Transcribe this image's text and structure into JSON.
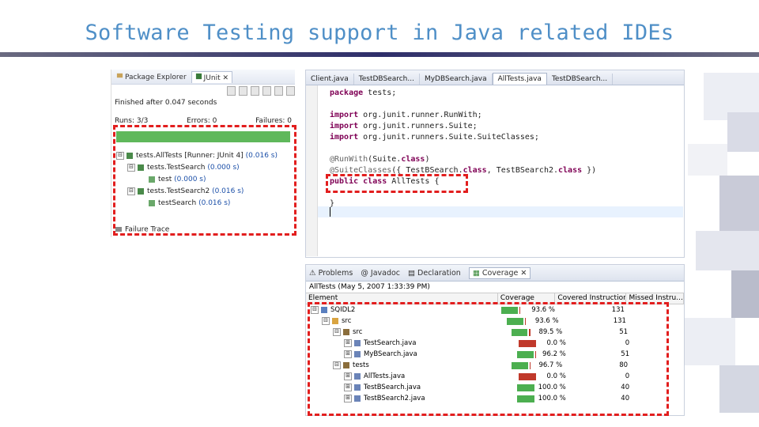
{
  "slide_title": "Software Testing support in Java related IDEs",
  "junit": {
    "tab_package_explorer": "Package Explorer",
    "tab_junit": "JUnit",
    "finished_text": "Finished after 0.047 seconds",
    "runs_label": "Runs: 3/3",
    "errors_label": "Errors: 0",
    "failures_label": "Failures: 0",
    "tree": [
      {
        "expander": "⊟",
        "name": "tests.AllTests [Runner: JUnit 4]",
        "time": "(0.016 s)",
        "indent": 0
      },
      {
        "expander": "⊟",
        "name": "tests.TestSearch",
        "time": "(0.000 s)",
        "indent": 1
      },
      {
        "expander": "",
        "name": "test",
        "time": "(0.000 s)",
        "indent": 2
      },
      {
        "expander": "⊟",
        "name": "tests.TestSearch2",
        "time": "(0.016 s)",
        "indent": 1
      },
      {
        "expander": "",
        "name": "testSearch",
        "time": "(0.016 s)",
        "indent": 2
      }
    ],
    "failure_trace_label": "Failure Trace"
  },
  "editor": {
    "tabs": [
      "Client.java",
      "TestDBSearch...",
      "MyDBSearch.java",
      "AllTests.java",
      "TestDBSearch..."
    ],
    "active_tab": 3,
    "code": {
      "line1_kw": "package",
      "line1_rest": " tests;",
      "line2_kw": "import",
      "line2_rest": " org.junit.runner.RunWith;",
      "line3_kw": "import",
      "line3_rest": " org.junit.runners.Suite;",
      "line4_kw": "import",
      "line4_rest": " org.junit.runners.Suite.SuiteClasses;",
      "line5_ann": "@RunWith",
      "line5_a": "(Suite.",
      "line5_kw": "class",
      "line5_b": ")",
      "line6_ann": "@SuiteClasses",
      "line6_a": "({ TestBSearch.",
      "line6_kw1": "class",
      "line6_b": ", TestBSearch2.",
      "line6_kw2": "class",
      "line6_c": " })",
      "line7_kw1": "public",
      "line7_kw2": "class",
      "line7_rest": " AllTests {",
      "line8": "}"
    }
  },
  "coverage": {
    "tabs": [
      "Problems",
      "Javadoc",
      "Declaration",
      "Coverage"
    ],
    "session": "AllTests (May 5, 2007 1:33:39 PM)",
    "headers": [
      "Element",
      "Coverage",
      "Covered Instructions",
      "Missed Instru..."
    ],
    "rows": [
      {
        "exp": "⊟",
        "name": "SQIDL2",
        "coverage": "93.6 %",
        "green": 0.936,
        "covered": "131",
        "indent": 0,
        "icon": "project-icon"
      },
      {
        "exp": "⊟",
        "name": "src",
        "coverage": "93.6 %",
        "green": 0.936,
        "covered": "131",
        "indent": 1,
        "icon": "folder-icon"
      },
      {
        "exp": "⊟",
        "name": "src",
        "coverage": "89.5 %",
        "green": 0.895,
        "covered": "51",
        "indent": 2,
        "icon": "package-icon"
      },
      {
        "exp": "⊞",
        "name": "TestSearch.java",
        "coverage": "0.0 %",
        "green": 0.0,
        "covered": "0",
        "indent": 3,
        "icon": "java-file-icon"
      },
      {
        "exp": "⊞",
        "name": "MyBSearch.java",
        "coverage": "96.2 %",
        "green": 0.962,
        "covered": "51",
        "indent": 3,
        "icon": "java-file-icon"
      },
      {
        "exp": "⊟",
        "name": "tests",
        "coverage": "96.7 %",
        "green": 0.967,
        "covered": "80",
        "indent": 2,
        "icon": "package-icon"
      },
      {
        "exp": "⊞",
        "name": "AllTests.java",
        "coverage": "0.0 %",
        "green": 0.0,
        "covered": "0",
        "indent": 3,
        "icon": "java-file-icon"
      },
      {
        "exp": "⊞",
        "name": "TestBSearch.java",
        "coverage": "100.0 %",
        "green": 1.0,
        "covered": "40",
        "indent": 3,
        "icon": "java-file-icon"
      },
      {
        "exp": "⊞",
        "name": "TestBSearch2.java",
        "coverage": "100.0 %",
        "green": 1.0,
        "covered": "40",
        "indent": 3,
        "icon": "java-file-icon"
      }
    ]
  },
  "colors": {
    "title": "#4f8fc7",
    "highlight_dash": "#e21e1e",
    "junit_bar": "#5fb85b"
  }
}
